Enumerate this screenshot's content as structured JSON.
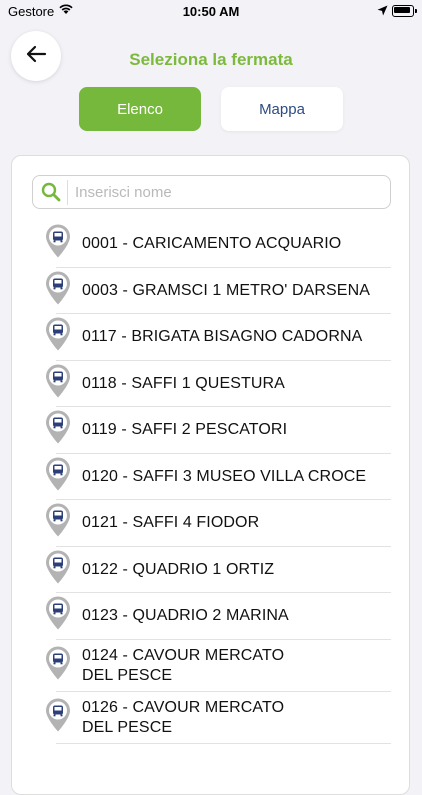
{
  "status": {
    "carrier": "Gestore",
    "time": "10:50 AM"
  },
  "header": {
    "title": "Seleziona la fermata",
    "tabs": {
      "list": "Elenco",
      "map": "Mappa"
    }
  },
  "search": {
    "placeholder": "Inserisci nome",
    "value": ""
  },
  "stops": [
    "0001 - CARICAMENTO ACQUARIO",
    "0003 - GRAMSCI 1 METRO' DARSENA",
    "0117 - BRIGATA BISAGNO CADORNA",
    "0118 - SAFFI 1 QUESTURA",
    "0119 - SAFFI 2 PESCATORI",
    "0120 - SAFFI 3 MUSEO VILLA CROCE",
    "0121 - SAFFI 4 FIODOR",
    "0122 - QUADRIO 1 ORTIZ",
    "0123 - QUADRIO 2 MARINA",
    "0124 - CAVOUR MERCATO DEL PESCE",
    "0126 - CAVOUR MERCATO DEL PESCE"
  ],
  "colors": {
    "accent": "#76b83c",
    "title": "#7dba3c",
    "mapTab": "#2d4b84",
    "pinBus": "#2d3f78"
  }
}
